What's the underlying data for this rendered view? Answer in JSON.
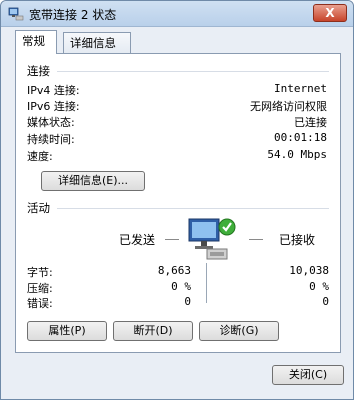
{
  "window": {
    "title": "宽带连接 2 状态",
    "close_label": "X"
  },
  "tabs": [
    {
      "label": "常规"
    },
    {
      "label": "详细信息"
    }
  ],
  "connection": {
    "heading": "连接",
    "rows": [
      {
        "label": "IPv4 连接:",
        "value": "Internet"
      },
      {
        "label": "IPv6 连接:",
        "value": "无网络访问权限"
      },
      {
        "label": "媒体状态:",
        "value": "已连接"
      },
      {
        "label": "持续时间:",
        "value": "00:01:18"
      },
      {
        "label": "速度:",
        "value": "54.0 Mbps"
      }
    ],
    "details_button": "详细信息(E)..."
  },
  "activity": {
    "heading": "活动",
    "sent_label": "已发送",
    "received_label": "已接收",
    "rows": [
      {
        "label": "字节:",
        "sent": "8,663",
        "received": "10,038"
      },
      {
        "label": "压缩:",
        "sent": "0 %",
        "received": "0 %"
      },
      {
        "label": "错误:",
        "sent": "0",
        "received": "0"
      }
    ]
  },
  "buttons": {
    "properties": "属性(P)",
    "disconnect": "断开(D)",
    "diagnose": "诊断(G)",
    "close": "关闭(C)"
  }
}
